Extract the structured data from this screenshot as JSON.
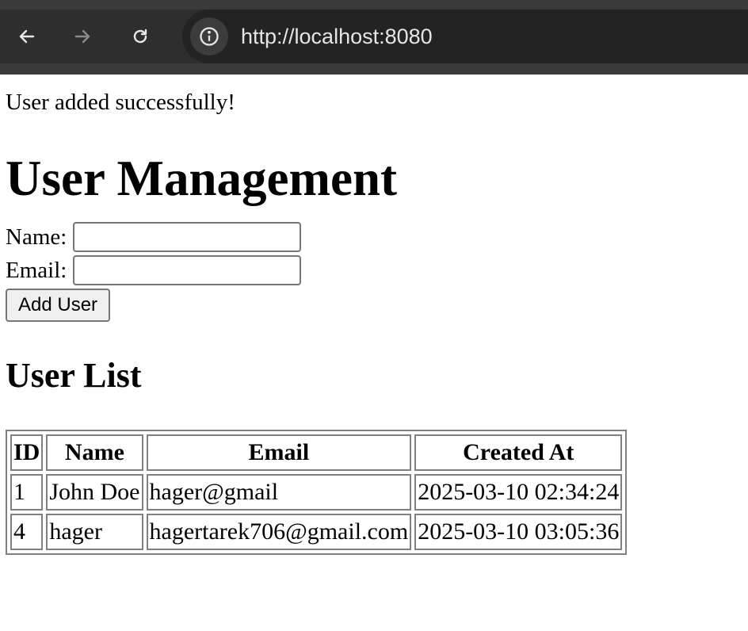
{
  "browser": {
    "url": "http://localhost:8080",
    "icons": {
      "back": "back-arrow-icon",
      "forward": "forward-arrow-icon",
      "reload": "reload-icon",
      "info": "info-icon"
    }
  },
  "page": {
    "success_message": "User added successfully!",
    "title": "User Management",
    "form": {
      "name_label": "Name:",
      "name_value": "",
      "email_label": "Email:",
      "email_value": "",
      "submit_label": "Add User"
    },
    "list_title": "User List",
    "table": {
      "headers": [
        "ID",
        "Name",
        "Email",
        "Created At"
      ],
      "rows": [
        [
          "1",
          "John Doe",
          "hager@gmail",
          "2025-03-10 02:34:24"
        ],
        [
          "4",
          "hager",
          "hagertarek706@gmail.com",
          "2025-03-10 03:05:36"
        ]
      ]
    }
  }
}
